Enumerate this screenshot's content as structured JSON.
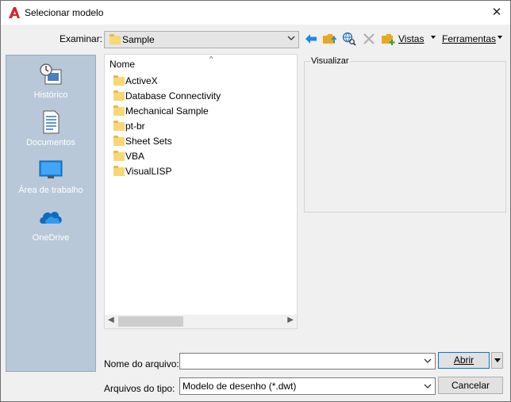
{
  "window": {
    "title": "Selecionar modelo",
    "close_glyph": "✕"
  },
  "toolbar": {
    "look_in_label": "Examinar:",
    "look_in_value": "Sample",
    "views_label": "Vistas",
    "tools_label": "Ferramentas",
    "icons": [
      "back-arrow-icon",
      "folder-up-icon",
      "search-web-icon",
      "delete-icon",
      "new-folder-icon"
    ]
  },
  "places": [
    {
      "label": "Histórico",
      "icon": "history-icon"
    },
    {
      "label": "Documentos",
      "icon": "documents-icon"
    },
    {
      "label": "Área de trabalho",
      "icon": "desktop-icon"
    },
    {
      "label": "OneDrive",
      "icon": "onedrive-icon"
    }
  ],
  "filelist": {
    "column_header": "Nome",
    "items": [
      "ActiveX",
      "Database Connectivity",
      "Mechanical Sample",
      "pt-br",
      "Sheet Sets",
      "VBA",
      "VisualLISP"
    ]
  },
  "preview": {
    "label": "Visualizar"
  },
  "bottom": {
    "filename_label": "Nome do arquivo:",
    "filename_value": "",
    "filetype_label": "Arquivos do tipo:",
    "filetype_value": "Modelo de desenho (*.dwt)",
    "open_label": "Abrir",
    "cancel_label": "Cancelar"
  },
  "colors": {
    "places_bg": "#b8c8d8",
    "accent": "#0078d7",
    "folder": "#f8d775",
    "app_icon_red": "#d9232e"
  }
}
